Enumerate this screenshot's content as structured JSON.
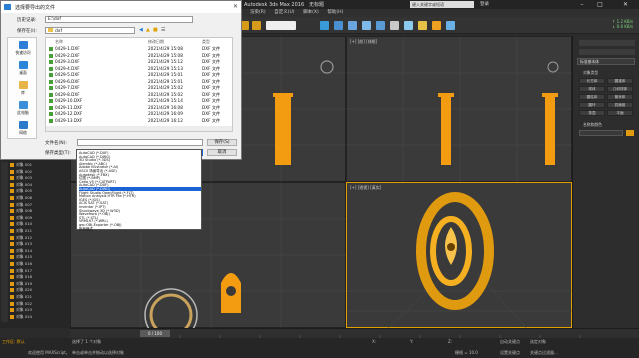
{
  "app": {
    "title": "Autodesk 3ds Max 2016",
    "file_name": "无标题",
    "search_placeholder": "键入关键字或短语",
    "signin": "登录",
    "menu": [
      "渲染(R)",
      "自定义(U)",
      "脚本(X)",
      "帮助(H)"
    ],
    "net": [
      "↑ 1.2 KB/s",
      "↓ 0.6 KB/s"
    ]
  },
  "viewports": {
    "top_left_label": "",
    "top_right_label": "[+] [前] [线框]",
    "bottom_right_label": "[+] [透视] [真实]"
  },
  "dialog": {
    "title": "选择要导出的文件",
    "history_label": "历史记录:",
    "history_value": "E:\\dxf",
    "location_label": "保存在(I):",
    "location_value": "dxf",
    "places": [
      "快速访问",
      "桌面",
      "库",
      "此电脑",
      "网络"
    ],
    "columns": [
      "名称",
      "修改日期",
      "类型"
    ],
    "files": [
      {
        "name": "0429-1.DXF",
        "date": "2021/4/29 15:08",
        "type": "DXF 文件"
      },
      {
        "name": "0429-2.DXF",
        "date": "2021/4/29 15:08",
        "type": "DXF 文件"
      },
      {
        "name": "0429-3.DXF",
        "date": "2021/4/29 15:12",
        "type": "DXF 文件"
      },
      {
        "name": "0429-4.DXF",
        "date": "2021/4/29 15:13",
        "type": "DXF 文件"
      },
      {
        "name": "0429-5.DXF",
        "date": "2021/4/29 15:01",
        "type": "DXF 文件"
      },
      {
        "name": "0429-6.DXF",
        "date": "2021/4/29 15:01",
        "type": "DXF 文件"
      },
      {
        "name": "0429-7.DXF",
        "date": "2021/4/29 15:02",
        "type": "DXF 文件"
      },
      {
        "name": "0429-8.DXF",
        "date": "2021/4/29 15:02",
        "type": "DXF 文件"
      },
      {
        "name": "0429-10.DXF",
        "date": "2021/4/29 15:14",
        "type": "DXF 文件"
      },
      {
        "name": "0429-11.DXF",
        "date": "2021/4/29 16:08",
        "type": "DXF 文件"
      },
      {
        "name": "0429-12.DXF",
        "date": "2021/4/29 16:09",
        "type": "DXF 文件"
      },
      {
        "name": "0429-13.DXF",
        "date": "2021/4/29 16:12",
        "type": "DXF 文件"
      }
    ],
    "filename_label": "文件名(N):",
    "filetype_label": "保存类型(T):",
    "filetype_value": "AutoCAD (*.DXF)",
    "save_button": "保存(S)",
    "cancel_button": "取消"
  },
  "type_options": [
    "AutoCAD (*.DXF)",
    "AutoCAD (*.DWG)",
    "3D Studio (*.3DS)",
    "Alembic (*.ABC)",
    "Adobe Illustrator (*.AI)",
    "ASCII 场景导出 (*.ASE)",
    "Autodesk (*.FBX)",
    "位图 (*.BMP)",
    "Catia V5 (*.CATPART)",
    "AutoCAD (*.DXF)",
    "AutoCAD (*.DWG)",
    "Flight Studio OpenFlight (*.FLT)",
    "Motion Analysis HTR File (*.HTR)",
    "IGES (*.IGS)",
    "ACIS SAT (*.SAT)",
    "Inventor (*.IPT)",
    "Shockwave 3D (*.W3D)",
    "Wavefront (*.OBJ)",
    "STL (*.STL)",
    "VRML97 (*.WRL)",
    "gw::OBJ-Exporter (*.OBJ)",
    "所有格式"
  ],
  "selected_type_index": 10,
  "command_panel": {
    "dropdown": "标准基本体",
    "section1": "对象类型",
    "buttons": [
      "长方体",
      "圆锥体",
      "球体",
      "几何球体",
      "圆柱体",
      "管状体",
      "圆环",
      "四棱锥",
      "茶壶",
      "平面"
    ],
    "section2": "名称和颜色"
  },
  "scene_items": [
    "对象 001",
    "对象 002",
    "对象 003",
    "对象 004",
    "对象 005",
    "对象 006",
    "对象 007",
    "对象 008",
    "对象 009",
    "对象 010",
    "对象 011",
    "对象 012",
    "对象 013",
    "对象 014",
    "对象 015",
    "对象 016",
    "对象 017",
    "对象 018",
    "对象 019",
    "对象 020",
    "对象 021",
    "对象 022",
    "对象 023",
    "对象 024"
  ],
  "timeline": {
    "position": "0 / 100"
  },
  "status": {
    "workspace": "工作区: 默认",
    "selection": "选择了 1 个对象",
    "hint": "单击或单击并拖动以选择对象",
    "welcome": "欢迎使用 MAXScript。",
    "x_label": "X:",
    "y_label": "Y:",
    "z_label": "Z:",
    "grid": "栅格 = 10.0",
    "autokey": "自动关键点",
    "selected": "选定对象",
    "setkey": "设置关键点",
    "filter": "关键点过滤器..."
  },
  "colors": {
    "accent": "#f39c12",
    "selection": "#1a63d4",
    "viewport_bg": "#3a3a3a"
  }
}
